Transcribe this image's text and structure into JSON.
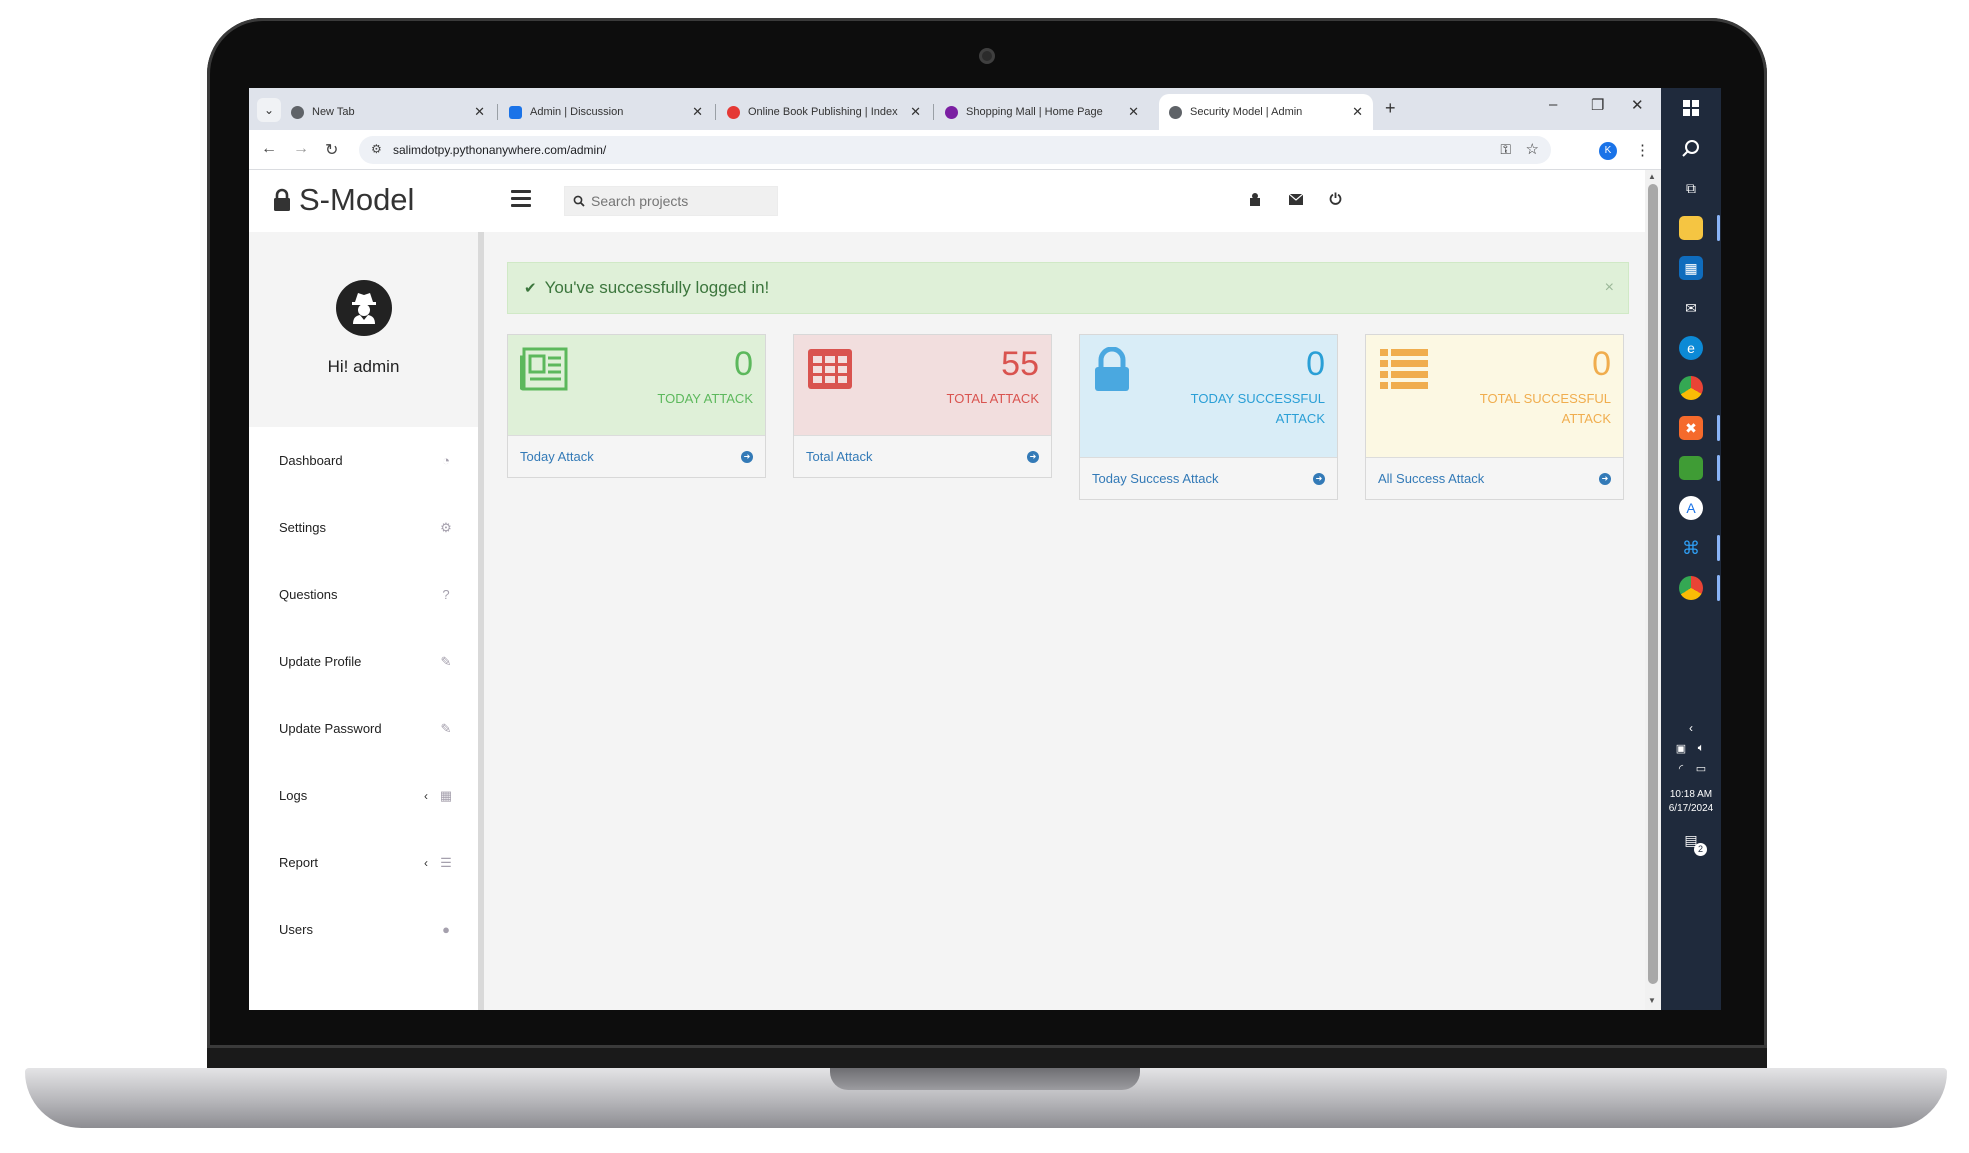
{
  "browser": {
    "tabs": [
      {
        "title": "New Tab",
        "favicon_color": "#5f6368"
      },
      {
        "title": "Admin | Discussion",
        "favicon_color": "#1a73e8"
      },
      {
        "title": "Online Book Publishing | Index",
        "favicon_color": "#e53935"
      },
      {
        "title": "Shopping Mall | Home Page",
        "favicon_color": "#7b1fa2"
      },
      {
        "title": "Security Model | Admin",
        "favicon_color": "#5f6368"
      }
    ],
    "url": "salimdotpy.pythonanywhere.com/admin/",
    "profile_initial": "K"
  },
  "header": {
    "brand": "S-Model",
    "search_placeholder": "Search projects"
  },
  "sidebar": {
    "greeting": "Hi! admin",
    "items": [
      {
        "label": "Dashboard",
        "icon": "dashboard-icon"
      },
      {
        "label": "Settings",
        "icon": "cogs-icon"
      },
      {
        "label": "Questions",
        "icon": "question-icon"
      },
      {
        "label": "Update Profile",
        "icon": "edit-icon"
      },
      {
        "label": "Update Password",
        "icon": "edit-icon"
      },
      {
        "label": "Logs",
        "icon": "table-icon"
      },
      {
        "label": "Report",
        "icon": "list-icon"
      },
      {
        "label": "Users",
        "icon": "user-icon"
      }
    ]
  },
  "alert": {
    "message": "You've successfully logged in!",
    "close": "×"
  },
  "cards": [
    {
      "value": "0",
      "caption": "TODAY ATTACK",
      "link": "Today Attack",
      "color": "#5cb85c",
      "bg": "#dff0d8",
      "icon": "newspaper-icon"
    },
    {
      "value": "55",
      "caption": "TOTAL ATTACK",
      "link": "Total Attack",
      "color": "#d9534f",
      "bg": "#f2dede",
      "icon": "table-icon"
    },
    {
      "value": "0",
      "caption": "TODAY SUCCESSFUL ATTACK",
      "link": "Today Success Attack",
      "color": "#2a9fd6",
      "bg": "#d9edf7",
      "icon": "lock-icon"
    },
    {
      "value": "0",
      "caption": "TOTAL SUCCESSFUL ATTACK",
      "link": "All Success Attack",
      "color": "#f0ad4e",
      "bg": "#fcf8e3",
      "icon": "list-icon"
    }
  ],
  "taskbar": {
    "time": "10:18 AM",
    "date": "6/17/2024",
    "notifications": "2"
  }
}
